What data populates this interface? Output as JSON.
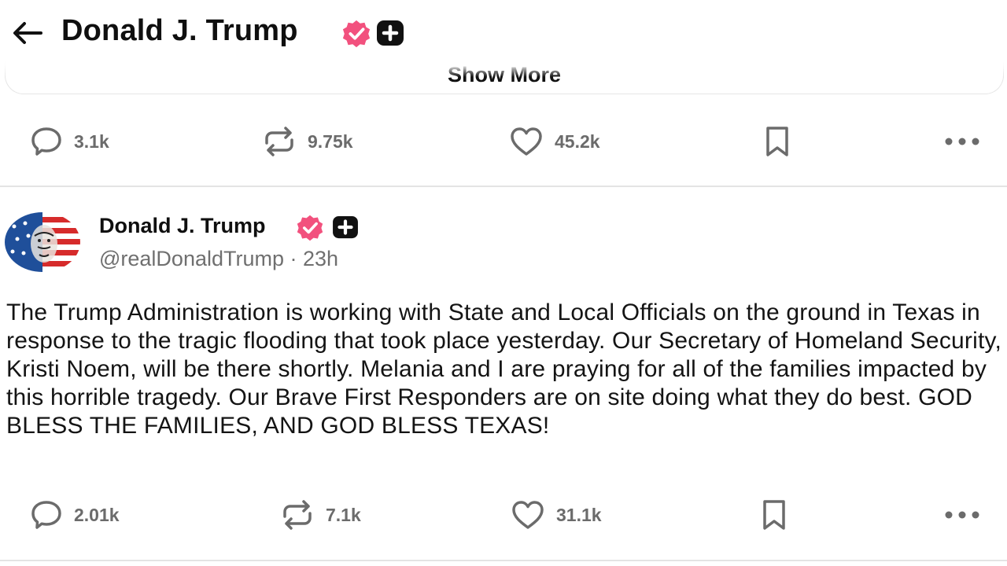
{
  "header": {
    "back_icon": "arrow-left-icon",
    "title": "Donald J. Trump",
    "verified_icon": "verified-badge-icon",
    "plus_icon": "subscription-plus-icon",
    "badge_color": "#f2517e"
  },
  "show_more": {
    "label": "Show More"
  },
  "previous_post": {
    "replies": "3.1k",
    "reposts": "9.75k",
    "likes": "45.2k"
  },
  "post": {
    "author_name": "Donald J. Trump",
    "handle_time": "@realDonaldTrump · 23h",
    "body": "The Trump Administration is working with State and Local Officials on the ground in Texas in response to the tragic flooding that took place yesterday. Our Secretary of Homeland Security, Kristi Noem, will be there shortly. Melania and I are praying for all of the families impacted by this horrible tragedy. Our Brave First Responders are on site doing what they do best. GOD BLESS THE FAMILIES, AND GOD BLESS TEXAS!",
    "replies": "2.01k",
    "reposts": "7.1k",
    "likes": "31.1k"
  },
  "icons": {
    "reply": "comment-bubble-icon",
    "repost": "repost-arrows-icon",
    "like": "heart-icon",
    "bookmark": "bookmark-icon",
    "more": "more-dots-icon"
  },
  "colors": {
    "text": "#0f0f0f",
    "muted": "#6b6b6b",
    "divider": "#e4e4e4"
  }
}
